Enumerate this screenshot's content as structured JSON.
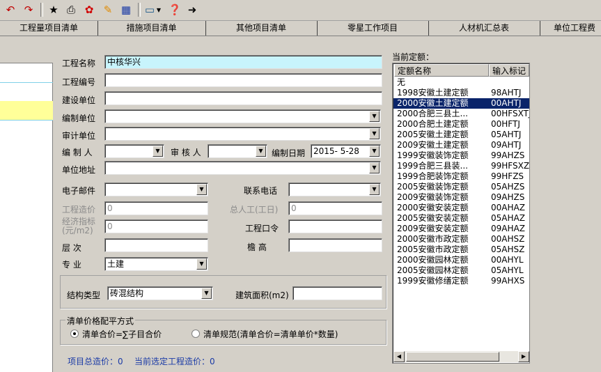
{
  "toolbar": {
    "icons": [
      "undo-icon",
      "redo-icon",
      "star-icon",
      "print-icon",
      "refresh-icon",
      "tools-icon",
      "calculator-icon",
      "keyboard-icon",
      "help-icon",
      "forward-icon"
    ]
  },
  "tabs": [
    "工程量项目清单",
    "措施项目清单",
    "其他项目清单",
    "零星工作项目",
    "人材机汇总表",
    "单位工程费"
  ],
  "form": {
    "project_name_label": "工程名称",
    "project_name_value": "中核华兴",
    "project_code_label": "工程编号",
    "project_code_value": "",
    "construction_unit_label": "建设单位",
    "construction_unit_value": "",
    "compile_unit_label": "编制单位",
    "compile_unit_value": "",
    "audit_unit_label": "审计单位",
    "audit_unit_value": "",
    "compiler_label": "编 制 人",
    "compiler_value": "",
    "auditor_label": "审 核 人",
    "auditor_value": "",
    "compile_date_label": "编制日期",
    "compile_date_value": "2015- 5-28",
    "address_label": "单位地址",
    "address_value": "",
    "email_label": "电子邮件",
    "email_value": "",
    "phone_label": "联系电话",
    "phone_value": "",
    "cost_label": "工程造价",
    "cost_value": "0",
    "labor_label": "总人工(工日)",
    "labor_value": "0",
    "econ_label_1": "经济指标",
    "econ_label_2": "(元/m2)",
    "econ_value": "0",
    "password_label": "工程口令",
    "password_value": "",
    "floors_label": "层    次",
    "floors_value": "",
    "eave_label": "檐  高",
    "eave_value": "",
    "specialty_label": "专    业",
    "specialty_value": "土建",
    "structure_label": "结构类型",
    "structure_value": "砖混结构",
    "area_label": "建筑面积(m2)",
    "area_value": ""
  },
  "pricing": {
    "group_label": "清单价格配平方式",
    "option1": "清单合价=∑子目合价",
    "option2": "清单规范(清单合价=清单单价*数量)",
    "selected": "option1"
  },
  "footer": {
    "total_text": "项目总造价：0",
    "current_text": "当前选定工程造价：0"
  },
  "quota": {
    "title": "当前定额：",
    "col_name": "定额名称",
    "col_code": "输入标记",
    "rows": [
      {
        "name": "无",
        "code": ""
      },
      {
        "name": "1998安徽土建定额",
        "code": "98AHTJ"
      },
      {
        "name": "2000安徽土建定额",
        "code": "00AHTJ"
      },
      {
        "name": "2000合肥三县土...",
        "code": "00HFSXTJ"
      },
      {
        "name": "2000合肥土建定额",
        "code": "00HFTJ"
      },
      {
        "name": "2005安徽土建定额",
        "code": "05AHTJ"
      },
      {
        "name": "2009安徽土建定额",
        "code": "09AHTJ"
      },
      {
        "name": "1999安徽装饰定额",
        "code": "99AHZS"
      },
      {
        "name": "1999合肥三县装...",
        "code": "99HFSXZS"
      },
      {
        "name": "1999合肥装饰定额",
        "code": "99HFZS"
      },
      {
        "name": "2005安徽装饰定额",
        "code": "05AHZS"
      },
      {
        "name": "2009安徽装饰定额",
        "code": "09AHZS"
      },
      {
        "name": "2000安徽安装定额",
        "code": "00AHAZ"
      },
      {
        "name": "2005安徽安装定额",
        "code": "05AHAZ"
      },
      {
        "name": "2009安徽安装定额",
        "code": "09AHAZ"
      },
      {
        "name": "2000安徽市政定额",
        "code": "00AHSZ"
      },
      {
        "name": "2005安徽市政定额",
        "code": "05AHSZ"
      },
      {
        "name": "2000安徽园林定额",
        "code": "00AHYL"
      },
      {
        "name": "2005安徽园林定额",
        "code": "05AHYL"
      },
      {
        "name": "1999安徽修缮定额",
        "code": "99AHXS"
      }
    ],
    "selected_index": 2
  },
  "colors": {
    "selection": "#0a246a",
    "highlight_input": "#c8f4fc",
    "left_selected_row": "#ffff99",
    "link_blue": "#1a3aa6"
  }
}
